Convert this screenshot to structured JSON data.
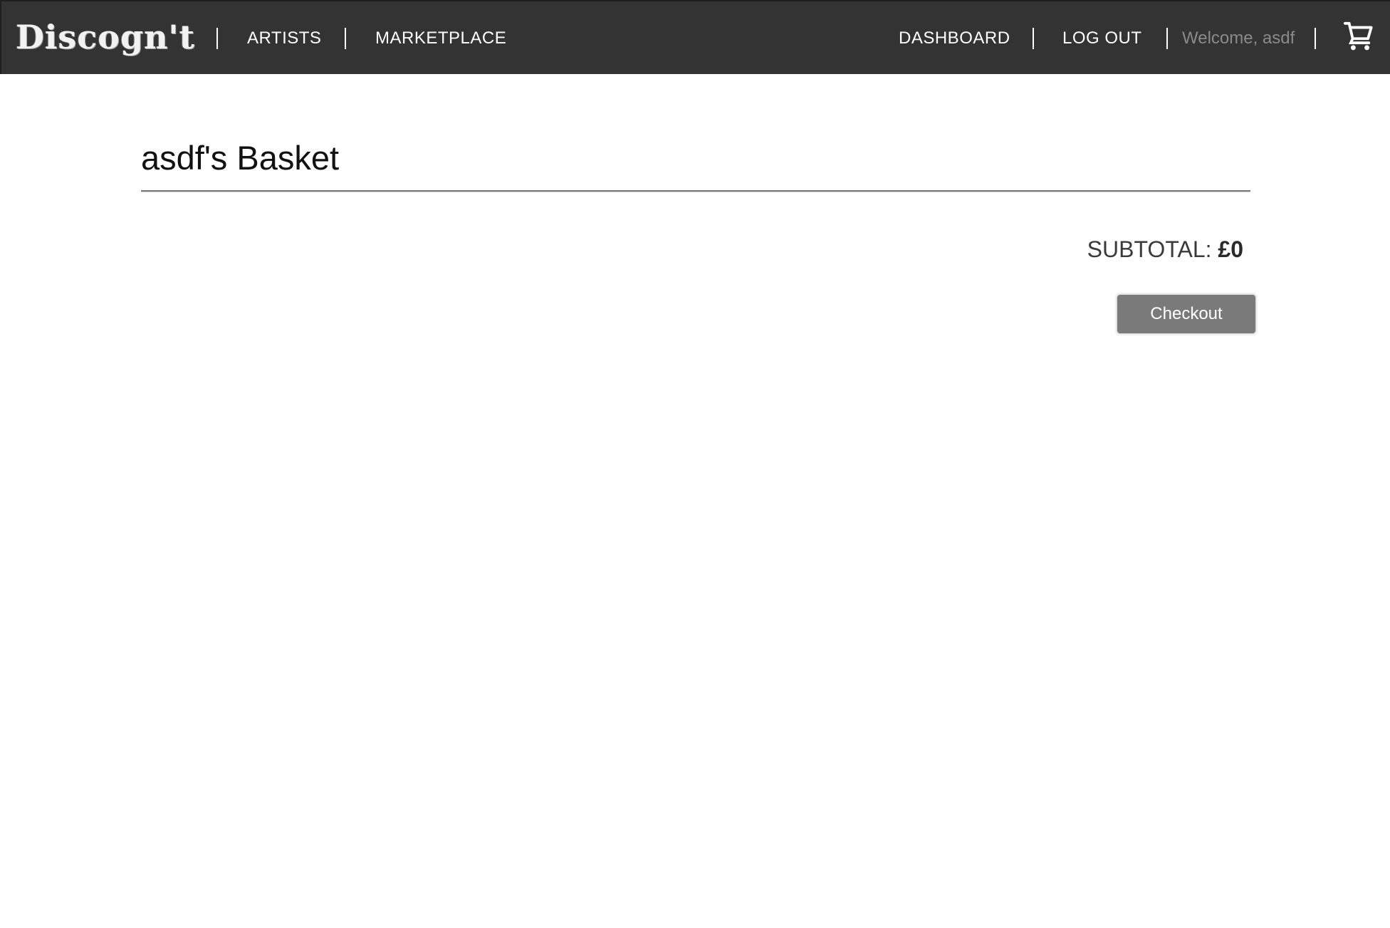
{
  "header": {
    "logo_text": "Discogn't",
    "nav_left": [
      {
        "label": "ARTISTS"
      },
      {
        "label": "MARKETPLACE"
      }
    ],
    "nav_right": [
      {
        "label": "DASHBOARD"
      },
      {
        "label": "LOG OUT"
      }
    ],
    "welcome_text": "Welcome, asdf",
    "cart_icon": "shopping-cart-icon"
  },
  "main": {
    "title": "asdf's Basket",
    "subtotal_label": "SUBTOTAL: ",
    "subtotal_value": "£0",
    "checkout_label": "Checkout"
  },
  "colors": {
    "navbar_bg": "#333333",
    "nav_text": "#ffffff",
    "welcome_text": "#8a8a8a",
    "button_bg": "#7a7a7a"
  }
}
